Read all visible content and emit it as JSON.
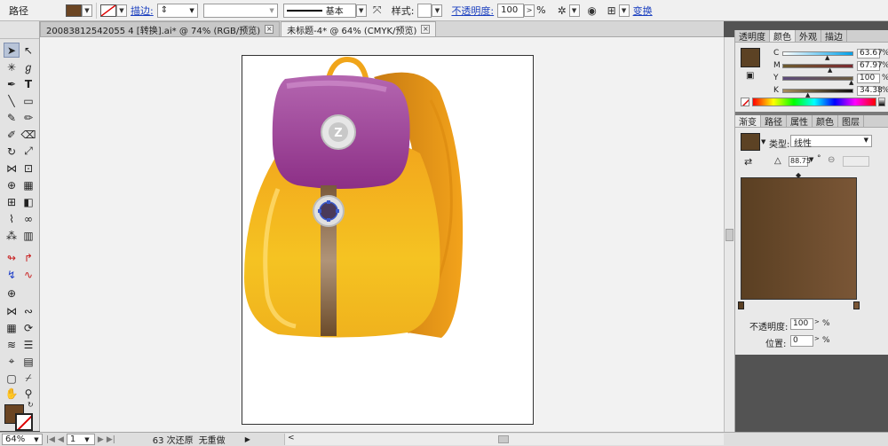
{
  "control_bar": {
    "object_type": "路径",
    "fill_color": "#6b4523",
    "stroke_label": "描边:",
    "stroke_profile": "基本",
    "style_label": "样式:",
    "opacity_label": "不透明度:",
    "opacity_value": "100",
    "opacity_unit": "%",
    "transform_label": "变换"
  },
  "document_tabs": [
    {
      "label": "20083812542055 4 [转换].ai* @ 74% (RGB/预览)"
    },
    {
      "label": "未标题-4* @ 64% (CMYK/预览)"
    }
  ],
  "color_panel": {
    "tabs": [
      "透明度",
      "颜色",
      "外观",
      "描边"
    ],
    "active_tab": "颜色",
    "swatch": "#5c4224",
    "channels": [
      {
        "label": "C",
        "value": "63.67",
        "fraction": 0.64,
        "gradient": "linear-gradient(90deg,#fff,#00a0e9)"
      },
      {
        "label": "M",
        "value": "67.97",
        "fraction": 0.68,
        "gradient": "linear-gradient(90deg,#6b5a2e,#7a2a30)"
      },
      {
        "label": "Y",
        "value": "100",
        "fraction": 1.0,
        "gradient": "linear-gradient(90deg,#5c4a7a,#6b5c40)"
      },
      {
        "label": "K",
        "value": "34.38",
        "fraction": 0.34,
        "gradient": "linear-gradient(90deg,#a88d5a,#111)"
      }
    ],
    "unit": "%"
  },
  "gradient_panel": {
    "tabs": [
      "渐变",
      "路径",
      "属性",
      "颜色",
      "图层"
    ],
    "active_tab": "渐变",
    "type_label": "类型:",
    "type_value": "线性",
    "angle_value": "88.75",
    "angle_unit": "°",
    "gradient_start": "#5a3f22",
    "gradient_end": "#7a5636",
    "opacity_label": "不透明度:",
    "opacity_value": "100",
    "position_label": "位置:",
    "position_value": "0",
    "unit": "%"
  },
  "status_bar": {
    "zoom": "64%",
    "page": "1",
    "undo_info": "63 次还原",
    "redo_info": "无重做"
  },
  "colors": {
    "bag_yellow": "#f2b421",
    "bag_orange": "#e8950f",
    "flap_purple": "#9b3d8f",
    "strap_brown": "#6b4b2a",
    "badge_silver": "#d9d9d9",
    "selection_blue": "#3a58c9"
  }
}
